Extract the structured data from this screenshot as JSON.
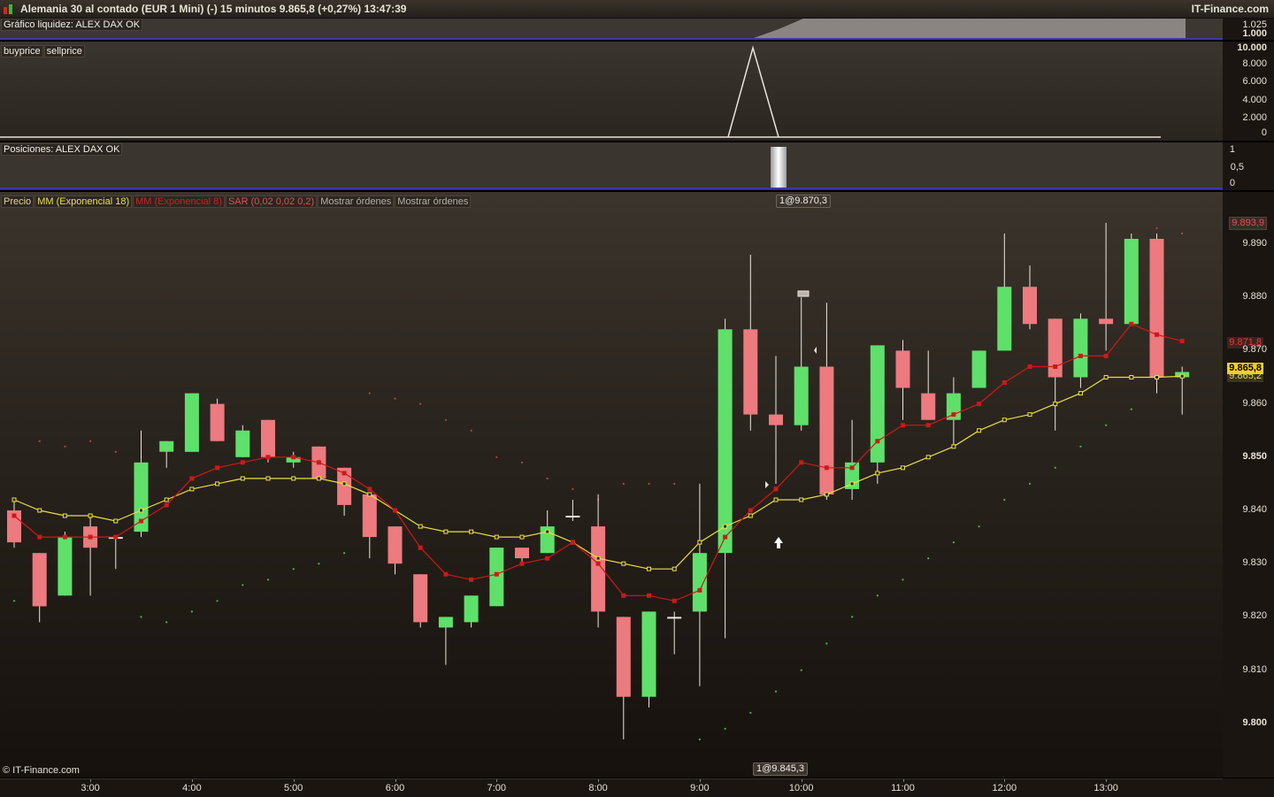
{
  "header": {
    "title": "Alemania 30 al contado (EUR 1 Mini) (-)   15 minutos   9.865,8 (+0,27%)   13:47:39",
    "brand": "IT-Finance.com",
    "copyright": "© IT-Finance.com"
  },
  "panels": {
    "liquidity": {
      "label": "Gráfico liquidez: ALEX  DAX OK",
      "ticks": [
        "1.025",
        "1.000"
      ]
    },
    "buysell": {
      "labels": [
        "buyprice",
        "sellprice"
      ],
      "ticks": [
        "10.000",
        "8.000",
        "6.000",
        "4.000",
        "2.000",
        "0"
      ]
    },
    "positions": {
      "label": "Posiciones: ALEX  DAX OK",
      "ticks": [
        "1",
        "0,5",
        "0"
      ]
    },
    "price": {
      "legend": [
        {
          "text": "Precio",
          "color": "#e8d48a"
        },
        {
          "text": "MM (Exponencial 18)",
          "color": "#e8e04a"
        },
        {
          "text": "MM (Exponencial 8)",
          "color": "#d02020"
        },
        {
          "text": "SAR (0,02 0,02 0,2)",
          "color": "#e05050"
        },
        {
          "text": "Mostrar órdenes",
          "color": "#cfc8bc"
        },
        {
          "text": "Mostrar órdenes",
          "color": "#cfc8bc"
        }
      ],
      "order_top": "1@9.870,3",
      "order_bottom": "1@9.845,3"
    }
  },
  "colors": {
    "up": "#5fe06a",
    "down": "#ec7a7e",
    "ema8": "#d01818",
    "ema18": "#e8e040",
    "sar_up": "#3fbf3f",
    "sar_down": "#c04040"
  },
  "chart_data": {
    "type": "candlestick",
    "interval": "15 minutos",
    "ylim": [
      9795,
      9898
    ],
    "y_ticks": [
      "9.890",
      "9.880",
      "9.870",
      "9.860",
      "9.850",
      "9.840",
      "9.830",
      "9.820",
      "9.810",
      "9.800"
    ],
    "y_tick_values": [
      9890,
      9880,
      9870,
      9860,
      9850,
      9840,
      9830,
      9820,
      9810,
      9800
    ],
    "x_ticks": [
      {
        "label": "3:00",
        "i": 3
      },
      {
        "label": "4:00",
        "i": 7
      },
      {
        "label": "5:00",
        "i": 11
      },
      {
        "label": "6:00",
        "i": 15
      },
      {
        "label": "7:00",
        "i": 19
      },
      {
        "label": "8:00",
        "i": 23
      },
      {
        "label": "9:00",
        "i": 27
      },
      {
        "label": "10:00",
        "i": 31
      },
      {
        "label": "11:00",
        "i": 35
      },
      {
        "label": "12:00",
        "i": 39
      },
      {
        "label": "13:00",
        "i": 43
      }
    ],
    "candles": [
      {
        "o": 9840,
        "h": 9842,
        "c": 9834,
        "l": 9833
      },
      {
        "o": 9832,
        "h": 9832,
        "c": 9822,
        "l": 9819
      },
      {
        "o": 9824,
        "h": 9836,
        "c": 9835,
        "l": 9824
      },
      {
        "o": 9837,
        "h": 9839,
        "c": 9833,
        "l": 9824
      },
      {
        "o": 9835,
        "h": 9835,
        "c": 9835,
        "l": 9829
      },
      {
        "o": 9836,
        "h": 9855,
        "c": 9849,
        "l": 9835
      },
      {
        "o": 9851,
        "h": 9853,
        "c": 9853,
        "l": 9848
      },
      {
        "o": 9851,
        "h": 9862,
        "c": 9862,
        "l": 9851
      },
      {
        "o": 9860,
        "h": 9861,
        "c": 9853,
        "l": 9853
      },
      {
        "o": 9850,
        "h": 9856,
        "c": 9855,
        "l": 9850
      },
      {
        "o": 9857,
        "h": 9857,
        "c": 9850,
        "l": 9849
      },
      {
        "o": 9849,
        "h": 9851,
        "c": 9850,
        "l": 9848
      },
      {
        "o": 9852,
        "h": 9852,
        "c": 9846,
        "l": 9846
      },
      {
        "o": 9848,
        "h": 9848,
        "c": 9841,
        "l": 9839
      },
      {
        "o": 9843,
        "h": 9843,
        "c": 9835,
        "l": 9831
      },
      {
        "o": 9837,
        "h": 9837,
        "c": 9830,
        "l": 9828
      },
      {
        "o": 9828,
        "h": 9828,
        "c": 9819,
        "l": 9818
      },
      {
        "o": 9818,
        "h": 9820,
        "c": 9820,
        "l": 9811
      },
      {
        "o": 9819,
        "h": 9824,
        "c": 9824,
        "l": 9818
      },
      {
        "o": 9822,
        "h": 9832,
        "c": 9833,
        "l": 9822
      },
      {
        "o": 9833,
        "h": 9833,
        "c": 9831,
        "l": 9830
      },
      {
        "o": 9832,
        "h": 9840,
        "c": 9837,
        "l": 9832
      },
      {
        "o": 9839,
        "h": 9842,
        "c": 9839,
        "l": 9838
      },
      {
        "o": 9837,
        "h": 9843,
        "c": 9821,
        "l": 9818
      },
      {
        "o": 9820,
        "h": 9820,
        "c": 9805,
        "l": 9797
      },
      {
        "o": 9805,
        "h": 9821,
        "c": 9821,
        "l": 9803
      },
      {
        "o": 9820,
        "h": 9821,
        "c": 9820,
        "l": 9813
      },
      {
        "o": 9821,
        "h": 9845,
        "c": 9832,
        "l": 9807
      },
      {
        "o": 9832,
        "h": 9876,
        "c": 9874,
        "l": 9816
      },
      {
        "o": 9874,
        "h": 9888,
        "c": 9858,
        "l": 9855
      },
      {
        "o": 9858,
        "h": 9869,
        "c": 9856,
        "l": 9845
      },
      {
        "o": 9856,
        "h": 9880,
        "c": 9867,
        "l": 9855
      },
      {
        "o": 9867,
        "h": 9879,
        "c": 9843,
        "l": 9842
      },
      {
        "o": 9844,
        "h": 9857,
        "c": 9849,
        "l": 9842
      },
      {
        "o": 9849,
        "h": 9871,
        "c": 9871,
        "l": 9845
      },
      {
        "o": 9870,
        "h": 9872,
        "c": 9863,
        "l": 9857
      },
      {
        "o": 9862,
        "h": 9870,
        "c": 9857,
        "l": 9857
      },
      {
        "o": 9857,
        "h": 9865,
        "c": 9862,
        "l": 9852
      },
      {
        "o": 9863,
        "h": 9870,
        "c": 9870,
        "l": 9863
      },
      {
        "o": 9870,
        "h": 9892,
        "c": 9882,
        "l": 9870
      },
      {
        "o": 9882,
        "h": 9886,
        "c": 9875,
        "l": 9874
      },
      {
        "o": 9876,
        "h": 9876,
        "c": 9865,
        "l": 9855
      },
      {
        "o": 9865,
        "h": 9877,
        "c": 9876,
        "l": 9863
      },
      {
        "o": 9876,
        "h": 9894,
        "c": 9875,
        "l": 9870
      },
      {
        "o": 9875,
        "h": 9892,
        "c": 9891,
        "l": 9875
      },
      {
        "o": 9891,
        "h": 9892,
        "c": 9865,
        "l": 9862
      },
      {
        "o": 9865,
        "h": 9867,
        "c": 9866,
        "l": 9858
      }
    ],
    "ema8": [
      9839,
      9835,
      9835,
      9835,
      9835,
      9838,
      9841,
      9846,
      9848,
      9849,
      9850,
      9850,
      9849,
      9847,
      9844,
      9840,
      9833,
      9828,
      9827,
      9828,
      9830,
      9831,
      9834,
      9830,
      9824,
      9824,
      9823,
      9825,
      9835,
      9840,
      9844,
      9849,
      9848,
      9848,
      9853,
      9856,
      9856,
      9858,
      9860,
      9864,
      9867,
      9867,
      9869,
      9869,
      9875,
      9873,
      9871.8
    ],
    "ema18": [
      9842,
      9840,
      9839,
      9839,
      9838,
      9840,
      9842,
      9844,
      9845,
      9846,
      9846,
      9846,
      9846,
      9845,
      9843,
      9840,
      9837,
      9836,
      9836,
      9835,
      9835,
      9836,
      9834,
      9831,
      9830,
      9829,
      9829,
      9834,
      9837,
      9839,
      9842,
      9842,
      9843,
      9845,
      9847,
      9848,
      9850,
      9852,
      9855,
      9857,
      9858,
      9860,
      9862,
      9865,
      9865,
      9865,
      9865.2
    ],
    "sar": [
      {
        "i": 0,
        "v": 9823
      },
      {
        "i": 1,
        "v": 9853
      },
      {
        "i": 2,
        "v": 9852
      },
      {
        "i": 3,
        "v": 9853
      },
      {
        "i": 4,
        "v": 9851
      },
      {
        "i": 5,
        "v": 9820
      },
      {
        "i": 6,
        "v": 9819
      },
      {
        "i": 7,
        "v": 9821
      },
      {
        "i": 8,
        "v": 9823
      },
      {
        "i": 9,
        "v": 9826
      },
      {
        "i": 10,
        "v": 9827
      },
      {
        "i": 11,
        "v": 9829
      },
      {
        "i": 12,
        "v": 9830
      },
      {
        "i": 13,
        "v": 9832
      },
      {
        "i": 14,
        "v": 9862
      },
      {
        "i": 15,
        "v": 9861
      },
      {
        "i": 16,
        "v": 9860
      },
      {
        "i": 17,
        "v": 9857
      },
      {
        "i": 18,
        "v": 9855
      },
      {
        "i": 19,
        "v": 9850
      },
      {
        "i": 20,
        "v": 9849
      },
      {
        "i": 21,
        "v": 9846
      },
      {
        "i": 22,
        "v": 9844
      },
      {
        "i": 23,
        "v": 9842
      },
      {
        "i": 24,
        "v": 9845
      },
      {
        "i": 25,
        "v": 9845
      },
      {
        "i": 26,
        "v": 9845
      },
      {
        "i": 27,
        "v": 9797
      },
      {
        "i": 28,
        "v": 9799
      },
      {
        "i": 29,
        "v": 9802
      },
      {
        "i": 30,
        "v": 9806
      },
      {
        "i": 31,
        "v": 9810
      },
      {
        "i": 32,
        "v": 9815
      },
      {
        "i": 33,
        "v": 9820
      },
      {
        "i": 34,
        "v": 9824
      },
      {
        "i": 35,
        "v": 9827
      },
      {
        "i": 36,
        "v": 9831
      },
      {
        "i": 37,
        "v": 9834
      },
      {
        "i": 38,
        "v": 9837
      },
      {
        "i": 39,
        "v": 9842
      },
      {
        "i": 40,
        "v": 9845
      },
      {
        "i": 41,
        "v": 9848
      },
      {
        "i": 42,
        "v": 9852
      },
      {
        "i": 43,
        "v": 9856
      },
      {
        "i": 44,
        "v": 9859
      },
      {
        "i": 45,
        "v": 9893
      },
      {
        "i": 46,
        "v": 9892
      }
    ],
    "last_price": "9.865,8",
    "ema18_last": "9.865,2",
    "ema8_last": "9.871,8",
    "high_mark": "9.893,9",
    "buyprice_peak": 10000,
    "position_value": 1
  }
}
